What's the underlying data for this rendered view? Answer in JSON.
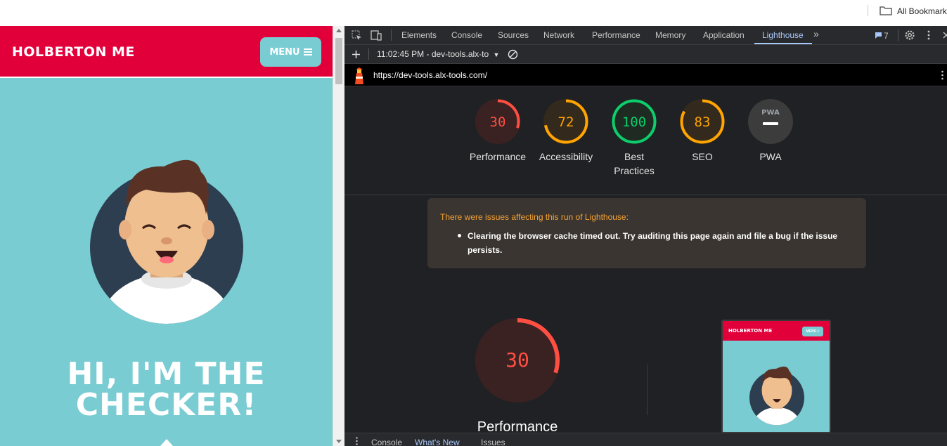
{
  "browser": {
    "bookmarks_label": "All Bookmarks"
  },
  "site": {
    "brand": "HOLBERTON ME",
    "menu_label": "MENU",
    "hero_line1": "HI, I'M THE",
    "hero_line2": "CHECKER!",
    "colors": {
      "header": "#e2003b",
      "background": "#79ccd2"
    }
  },
  "devtools": {
    "tabs": [
      "Elements",
      "Console",
      "Sources",
      "Network",
      "Performance",
      "Memory",
      "Application",
      "Lighthouse"
    ],
    "active_tab": "Lighthouse",
    "issues_count": "7",
    "report_time": "11:02:45 PM - dev-tools.alx-to",
    "url": "https://dev-tools.alx-tools.com/",
    "categories": [
      {
        "label": "Performance",
        "score": "30",
        "value": 30,
        "color": "#ff4e42"
      },
      {
        "label": "Accessibility",
        "score": "72",
        "value": 72,
        "color": "#ffa400"
      },
      {
        "label": "Best Practices",
        "score": "100",
        "value": 100,
        "color": "#0cce6b"
      },
      {
        "label": "SEO",
        "score": "83",
        "value": 83,
        "color": "#ffa400"
      },
      {
        "label": "PWA",
        "score": "PWA",
        "value": null,
        "color": "#9aa0a6"
      }
    ],
    "warning": {
      "title": "There were issues affecting this run of Lighthouse:",
      "item": "Clearing the browser cache timed out. Try auditing this page again and file a bug if the issue persists."
    },
    "detail": {
      "score": "30",
      "value": 30,
      "label": "Performance"
    },
    "thumbnail": {
      "brand": "HOLBERTON ME",
      "menu_label": "MENU ≡"
    },
    "drawer_tabs": [
      "Console",
      "What's New",
      "Issues"
    ],
    "drawer_active": "What's New"
  }
}
